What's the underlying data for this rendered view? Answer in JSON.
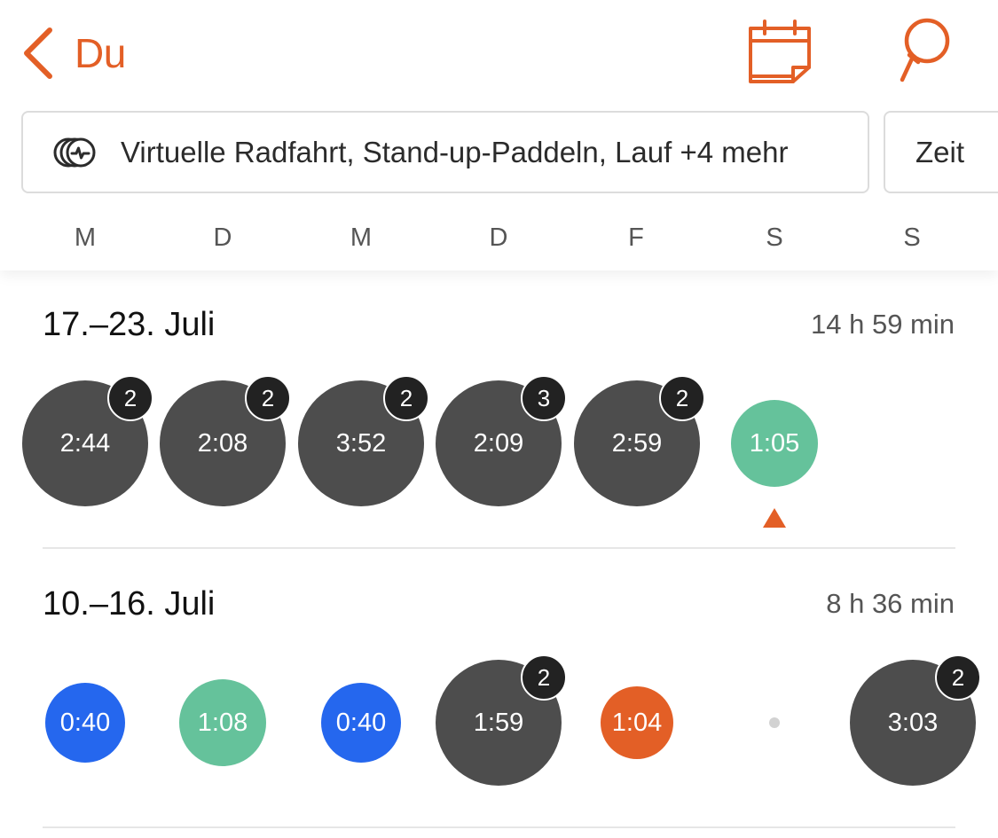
{
  "header": {
    "back_label": "Du",
    "accent_color": "#e35f26",
    "icons": [
      "chevron-left-icon",
      "calendar-icon",
      "search-icon"
    ]
  },
  "filter": {
    "text": "Virtuelle Radfahrt, Stand-up-Paddeln, Lauf +4 mehr",
    "icon": "activity-stack-icon"
  },
  "time_filter": {
    "label": "Zeit"
  },
  "weekdays": [
    "M",
    "D",
    "M",
    "D",
    "F",
    "S",
    "S"
  ],
  "colors": {
    "multi_activity": "#4d4d4d",
    "green_activity": "#65c29b",
    "blue_activity": "#2567ee",
    "orange_activity": "#e35f26"
  },
  "weeks": [
    {
      "title": "17.–23. Juli",
      "total": "14 h 59 min",
      "days": [
        {
          "time": "2:44",
          "count": "2",
          "type": "gray"
        },
        {
          "time": "2:08",
          "count": "2",
          "type": "gray"
        },
        {
          "time": "3:52",
          "count": "2",
          "type": "gray"
        },
        {
          "time": "2:09",
          "count": "3",
          "type": "gray"
        },
        {
          "time": "2:59",
          "count": "2",
          "type": "gray"
        },
        {
          "time": "1:05",
          "count": "",
          "type": "green",
          "today": true
        },
        null
      ]
    },
    {
      "title": "10.–16. Juli",
      "total": "8 h 36 min",
      "days": [
        {
          "time": "0:40",
          "count": "",
          "type": "blue"
        },
        {
          "time": "1:08",
          "count": "",
          "type": "green"
        },
        {
          "time": "0:40",
          "count": "",
          "type": "blue"
        },
        {
          "time": "1:59",
          "count": "2",
          "type": "gray"
        },
        {
          "time": "1:04",
          "count": "",
          "type": "orange"
        },
        {
          "rest": true
        },
        {
          "time": "3:03",
          "count": "2",
          "type": "gray"
        }
      ]
    }
  ]
}
